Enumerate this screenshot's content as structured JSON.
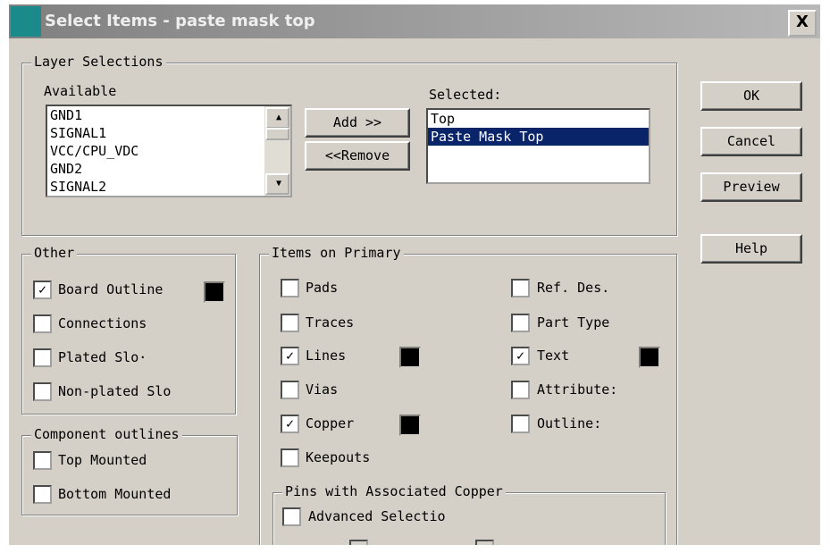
{
  "window": {
    "title": "Select Items - paste mask top",
    "close": "X"
  },
  "layer_selections": {
    "legend": "Layer Selections",
    "available_label": "Available",
    "available": [
      "GND1",
      "SIGNAL1",
      "VCC/CPU_VDC",
      "GND2",
      "SIGNAL2"
    ],
    "add": "Add >>",
    "remove": "<<Remove",
    "selected_label": "Selected:",
    "selected": [
      "Top",
      "Paste Mask Top"
    ]
  },
  "buttons": {
    "ok": "OK",
    "cancel": "Cancel",
    "preview": "Preview",
    "help": "Help"
  },
  "other": {
    "legend": "Other",
    "items": [
      {
        "label": "Board Outline",
        "checked": true
      },
      {
        "label": "Connections",
        "checked": false
      },
      {
        "label": "Plated Slo·",
        "checked": false
      },
      {
        "label": "Non-plated Slo",
        "checked": false
      }
    ]
  },
  "component_outlines": {
    "legend": "Component outlines",
    "items": [
      {
        "label": "Top Mounted",
        "checked": false
      },
      {
        "label": "Bottom Mounted",
        "checked": false
      }
    ]
  },
  "items_primary": {
    "legend": "Items on Primary",
    "left": [
      {
        "label": "Pads",
        "checked": false
      },
      {
        "label": "Traces",
        "checked": false
      },
      {
        "label": "Lines",
        "checked": true
      },
      {
        "label": "Vias",
        "checked": false
      },
      {
        "label": "Copper",
        "checked": true
      },
      {
        "label": "Keepouts",
        "checked": false
      }
    ],
    "right": [
      {
        "label": "Ref. Des.",
        "checked": false
      },
      {
        "label": "Part Type",
        "checked": false
      },
      {
        "label": "Text",
        "checked": true
      },
      {
        "label": "Attribute:",
        "checked": false
      },
      {
        "label": "Outline:",
        "checked": false
      }
    ]
  },
  "pins": {
    "legend": "Pins with Associated Copper",
    "advanced": "Advanced Selectio",
    "check": "✓"
  },
  "colors": {
    "swatch": "#000000",
    "highlight": "#0a246a"
  }
}
